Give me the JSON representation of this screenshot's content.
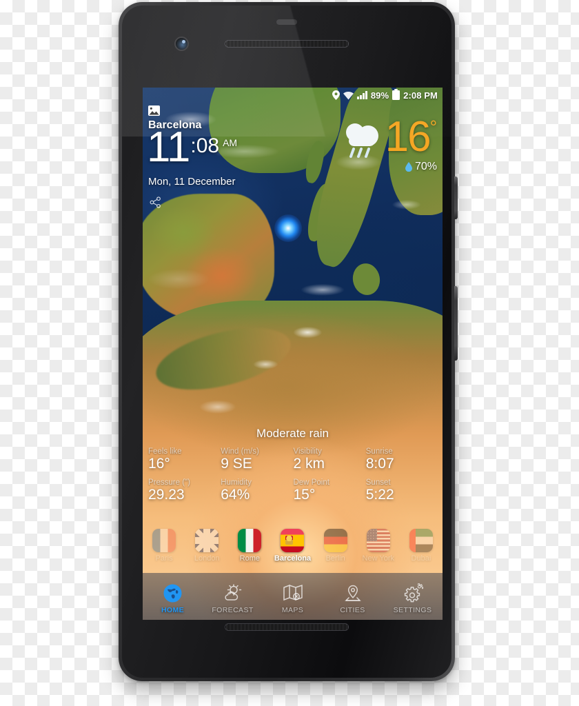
{
  "status_bar": {
    "location_icon": "location-pin-icon",
    "wifi_icon": "wifi-icon",
    "signal_icon": "signal-bars-icon",
    "battery_percent": "89%",
    "battery_icon": "battery-icon",
    "time": "2:08 PM"
  },
  "widget": {
    "photo_icon": "photo-icon",
    "share_icon": "share-icon",
    "city": "Barcelona",
    "hour": "11",
    "minute": ":08",
    "meridiem": "AM",
    "date": "Mon, 11 December",
    "weather_icon": "rain-cloud-icon",
    "temperature": "16",
    "degree": "°",
    "humidity_icon": "water-drop-icon",
    "humidity": "70%",
    "temp_color": "#f5a623"
  },
  "condition": "Moderate rain",
  "details": [
    {
      "label": "Feels like",
      "value": "16°"
    },
    {
      "label": "Wind (m/s)",
      "value": "9 SE"
    },
    {
      "label": "Visibility",
      "value": "2 km"
    },
    {
      "label": "Sunrise",
      "value": "8:07"
    },
    {
      "label": "Pressure (\")",
      "value": "29.23"
    },
    {
      "label": "Humidity",
      "value": "64%"
    },
    {
      "label": "Dew Point",
      "value": "15°"
    },
    {
      "label": "Sunset",
      "value": "5:22"
    }
  ],
  "cities": [
    {
      "label": "Paris",
      "flag": "flag-fr",
      "state": "edge"
    },
    {
      "label": "London",
      "flag": "flag-uk",
      "state": "dim"
    },
    {
      "label": "Rome",
      "flag": "flag-it",
      "state": "normal"
    },
    {
      "label": "Barcelona",
      "flag": "flag-es",
      "state": "active"
    },
    {
      "label": "Berlin",
      "flag": "flag-de",
      "state": "dim"
    },
    {
      "label": "New York",
      "flag": "flag-us",
      "state": "dim"
    },
    {
      "label": "Dubai",
      "flag": "flag-ae",
      "state": "edge"
    }
  ],
  "nav": [
    {
      "label": "HOME",
      "icon": "globe-icon",
      "active": true
    },
    {
      "label": "FORECAST",
      "icon": "sun-cloud-icon",
      "active": false
    },
    {
      "label": "MAPS",
      "icon": "map-icon",
      "active": false
    },
    {
      "label": "CITIES",
      "icon": "map-pin-icon",
      "active": false
    },
    {
      "label": "SETTINGS",
      "icon": "gear-icon",
      "active": false
    }
  ],
  "accent_color": "#2196f3"
}
